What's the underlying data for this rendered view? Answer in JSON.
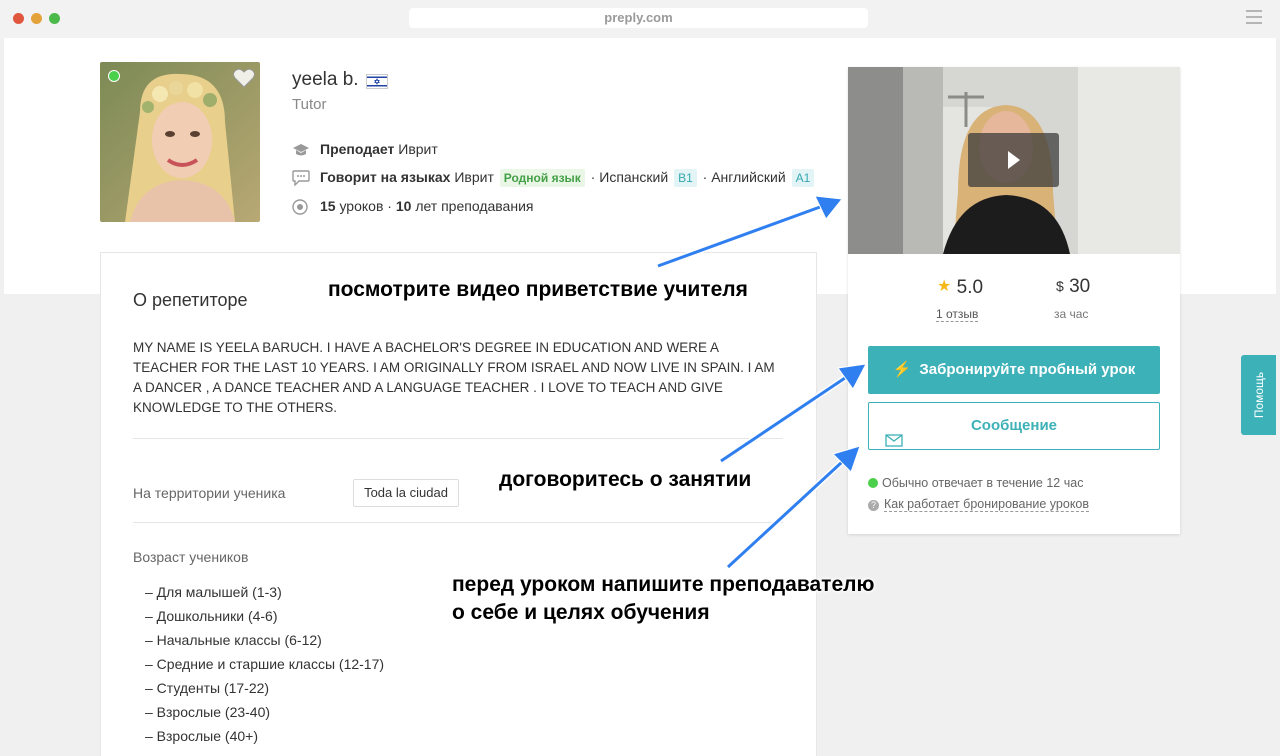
{
  "browser": {
    "url": "preply.com"
  },
  "tutor": {
    "name": "yeela b.",
    "role": "Tutor",
    "teaches_label": "Преподает",
    "teaches_value": "Иврит",
    "speaks_label": "Говорит на языках",
    "languages": [
      {
        "name": "Иврит",
        "level": "Родной язык"
      },
      {
        "name": "Испанский",
        "level": "B1"
      },
      {
        "name": "Английский",
        "level": "A1"
      }
    ],
    "lessons_count": "15",
    "lessons_label": "уроков",
    "years_count": "10",
    "years_label": "лет преподавания"
  },
  "about": {
    "title": "О репетиторе",
    "text": "MY NAME IS YEELA BARUCH. I HAVE A BACHELOR'S DEGREE IN EDUCATION AND WERE A TEACHER FOR THE LAST 10 YEARS. I AM ORIGINALLY FROM ISRAEL AND NOW LIVE IN SPAIN. I AM A DANCER , A DANCE TEACHER AND A LANGUAGE TEACHER . I LOVE TO TEACH AND GIVE KNOWLEDGE TO THE OTHERS.",
    "location_label": "На территории ученика",
    "location_value": "Toda la ciudad",
    "age_label": "Возраст учеников",
    "age_groups": [
      "– Для малышей (1-3)",
      "– Дошкольники (4-6)",
      "– Начальные классы (6-12)",
      "– Средние и старшие классы (12-17)",
      "– Студенты (17-22)",
      "– Взрослые (23-40)",
      "– Взрослые (40+)"
    ]
  },
  "booking": {
    "rating": "5.0",
    "reviews": "1 отзыв",
    "currency": "$",
    "price": "30",
    "per_hour": "за час",
    "book_label": "Забронируйте пробный урок",
    "message_label": "Сообщение",
    "response_time": "Обычно отвечает в течение 12 час",
    "how_it_works": "Как работает бронирование уроков"
  },
  "help": {
    "label": "Помощь"
  },
  "annotations": {
    "video": "посмотрите видео приветствие учителя",
    "book": "договоритесь о занятии",
    "message_line1": "перед уроком напишите преподавателю",
    "message_line2": "о себе и целях обучения"
  },
  "colors": {
    "accent": "#3db1b8",
    "arrow": "#2f7ff0",
    "online": "#4bd04b"
  }
}
